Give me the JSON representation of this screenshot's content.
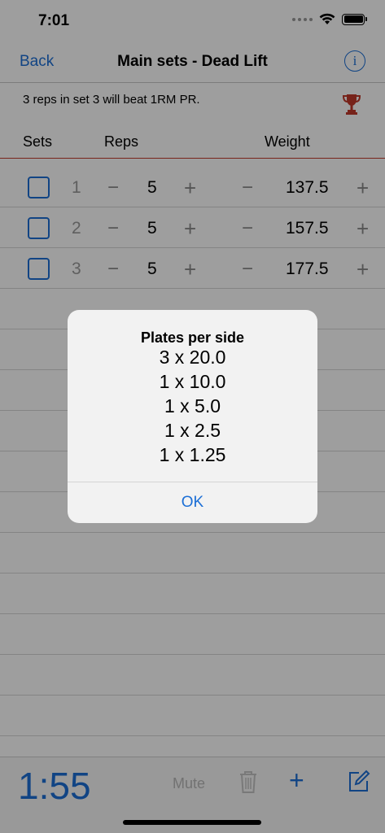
{
  "status": {
    "time": "7:01"
  },
  "nav": {
    "back": "Back",
    "title": "Main sets - Dead Lift",
    "info_glyph": "i"
  },
  "pr_message": "3 reps in set 3 will beat 1RM PR.",
  "columns": {
    "sets": "Sets",
    "reps": "Reps",
    "weight": "Weight"
  },
  "rows": [
    {
      "set": "1",
      "reps": "5",
      "weight": "137.5"
    },
    {
      "set": "2",
      "reps": "5",
      "weight": "157.5"
    },
    {
      "set": "3",
      "reps": "5",
      "weight": "177.5"
    }
  ],
  "symbols": {
    "minus": "−",
    "plus": "+"
  },
  "toolbar": {
    "timer": "1:55",
    "mute": "Mute",
    "add": "+"
  },
  "alert": {
    "title": "Plates per side",
    "lines": [
      "3 x 20.0",
      "1 x 10.0",
      "1 x 5.0",
      "1 x 2.5",
      "1 x 1.25"
    ],
    "ok": "OK"
  },
  "icons": [
    "wifi-icon",
    "battery-icon",
    "info-icon",
    "trophy-icon",
    "trash-icon",
    "compose-icon"
  ],
  "colors": {
    "accent": "#1c6fd6",
    "trophy": "#c0392b",
    "divider": "#c0392b"
  }
}
